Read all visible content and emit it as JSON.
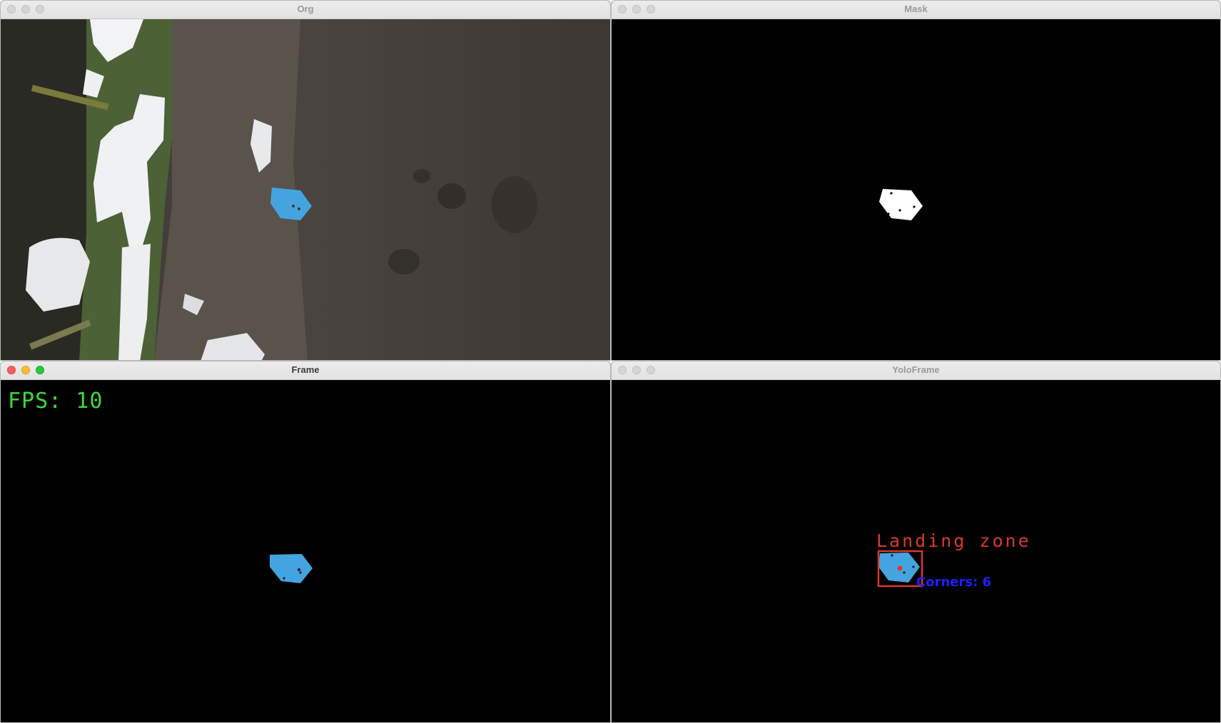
{
  "windows": {
    "org": {
      "title": "Org"
    },
    "mask": {
      "title": "Mask"
    },
    "frame": {
      "title": "Frame",
      "fps_text": "FPS: 10"
    },
    "yolo": {
      "title": "YoloFrame",
      "detection_label": "Landing zone",
      "corners_text": "Corners: 6"
    }
  },
  "colors": {
    "target_blue": "#44a4df",
    "fps_green": "#3bd93b",
    "detection_red": "#d8392b",
    "corners_blue": "#1f1fff"
  },
  "icons": [
    "close-button",
    "minimize-button",
    "zoom-button"
  ]
}
